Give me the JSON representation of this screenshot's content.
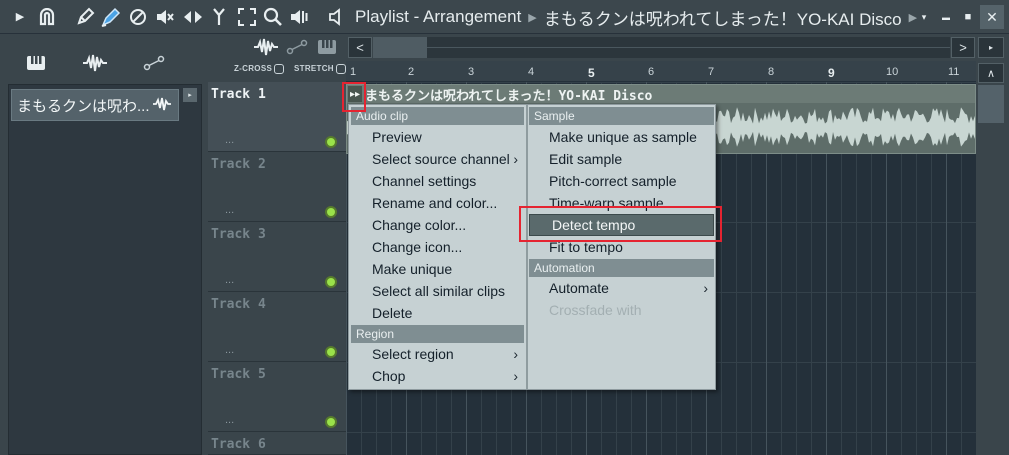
{
  "toolbar": {
    "icons": [
      "play-arrow-icon",
      "magnet-icon",
      "pencil-icon",
      "paint-brush-icon",
      "delete-icon",
      "mute-icon",
      "slip-icon",
      "slice-icon",
      "select-icon",
      "zoom-icon",
      "playback-icon",
      "speaker-icon"
    ],
    "title_parts": [
      "Playlist - Arrangement",
      "まもるクンは呪われてしまった！YO-KAI Disco"
    ],
    "arrow_glyph": "▶",
    "menu_glyph": "▾",
    "minimize": "▬",
    "maximize": "■",
    "close": "✕"
  },
  "browser": {
    "clip_name": "まもるクンは呪わ...",
    "scroll_glyph": "▸"
  },
  "playlist_tools": {
    "zcross_label": "Z-CROSS",
    "stretch_label": "STRETCH"
  },
  "hscroll": {
    "left": "<",
    "right": ">",
    "extra": "▸"
  },
  "ruler": {
    "bars": [
      "1",
      "2",
      "3",
      "4",
      "5",
      "6",
      "7",
      "8",
      "9",
      "10",
      "11"
    ]
  },
  "tracks": [
    {
      "name": "Track 1",
      "dots": "..."
    },
    {
      "name": "Track 2",
      "dots": "..."
    },
    {
      "name": "Track 3",
      "dots": "..."
    },
    {
      "name": "Track 4",
      "dots": "..."
    },
    {
      "name": "Track 5",
      "dots": "..."
    },
    {
      "name": "Track 6",
      "dots": "..."
    }
  ],
  "clip": {
    "title": "まもるクンは呪われてしまった！YO-KAI Disco",
    "menu_btn": "▸▸"
  },
  "vscroll": {
    "up": "∧"
  },
  "context_menu": {
    "left": {
      "header_audio": "Audio clip",
      "items": [
        {
          "label": "Preview",
          "submenu": false
        },
        {
          "label": "Select source channel",
          "submenu": true
        },
        {
          "label": "Channel settings",
          "submenu": false
        },
        {
          "label": "Rename and color...",
          "submenu": false
        },
        {
          "label": "Change color...",
          "submenu": false
        },
        {
          "label": "Change icon...",
          "submenu": false
        },
        {
          "label": "Make unique",
          "submenu": false
        },
        {
          "label": "Select all similar clips",
          "submenu": false
        },
        {
          "label": "Delete",
          "submenu": false
        }
      ],
      "header_region": "Region",
      "region_items": [
        {
          "label": "Select region",
          "submenu": true
        },
        {
          "label": "Chop",
          "submenu": true
        }
      ]
    },
    "right": {
      "header_sample": "Sample",
      "items": [
        {
          "label": "Make unique as sample"
        },
        {
          "label": "Edit sample"
        },
        {
          "label": "Pitch-correct sample"
        },
        {
          "label": "Time-warp sample"
        },
        {
          "label": "Detect tempo"
        },
        {
          "label": "Fit to tempo"
        }
      ],
      "header_automation": "Automation",
      "automation_items": [
        {
          "label": "Automate",
          "submenu": true
        },
        {
          "label": "Crossfade with",
          "disabled": true
        }
      ]
    },
    "arrow_glyph": "›"
  }
}
